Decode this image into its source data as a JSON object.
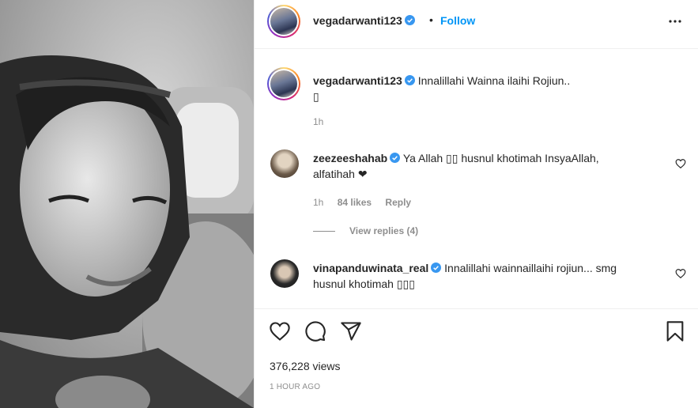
{
  "post": {
    "username": "vegadarwanti123",
    "follow_label": "Follow",
    "separator": "•",
    "verified": true,
    "accent_color": "#0095f6"
  },
  "caption": {
    "username": "vegadarwanti123",
    "text": "Innalillahi Wainna ilaihi Rojiun..",
    "text_line2": "▯",
    "time": "1h"
  },
  "comments": [
    {
      "username": "zeezeeshahab",
      "text": "Ya Allah ▯▯ husnul khotimah InsyaAllah,",
      "text_line2": "alfatihah ❤",
      "time": "1h",
      "likes": "84 likes",
      "reply": "Reply",
      "view_replies": "View replies (4)"
    },
    {
      "username": "vinapanduwinata_real",
      "text": "Innalillahi wainnaillaihi rojiun... smg",
      "text_line2": "husnul khotimah ▯▯▯"
    }
  ],
  "stats": {
    "views": "376,228 views",
    "posted": "1 HOUR AGO"
  },
  "icons": [
    "more-icon",
    "like-icon",
    "comment-icon",
    "share-icon",
    "save-icon",
    "verified-icon",
    "heart-icon"
  ]
}
